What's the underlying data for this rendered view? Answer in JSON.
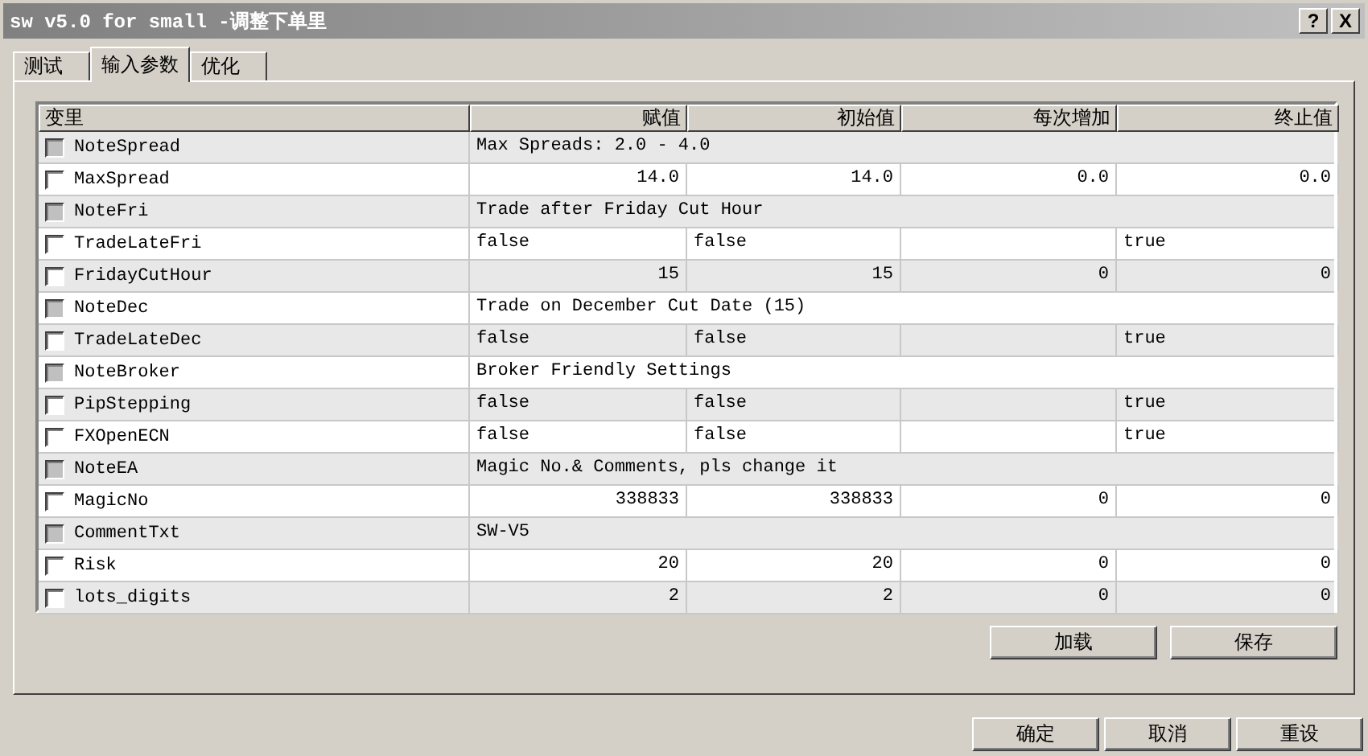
{
  "window": {
    "title": "sw v5.0 for small -调整下单里",
    "help": "?",
    "close": "X"
  },
  "tabs": [
    {
      "label": "测试",
      "selected": false
    },
    {
      "label": "输入参数",
      "selected": true
    },
    {
      "label": "优化",
      "selected": false
    }
  ],
  "table": {
    "columns": [
      "变里",
      "赋值",
      "初始值",
      "每次增加",
      "终止值"
    ],
    "rows": [
      {
        "kind": "note",
        "name": "NoteSpread",
        "checked": false,
        "value": "Max Spreads: 2.0 - 4.0"
      },
      {
        "kind": "number",
        "name": "MaxSpread",
        "checked": false,
        "value": "14.0",
        "start": "14.0",
        "step": "0.0",
        "stop": "0.0"
      },
      {
        "kind": "note",
        "name": "NoteFri",
        "checked": false,
        "value": "Trade after Friday Cut Hour"
      },
      {
        "kind": "bool",
        "name": "TradeLateFri",
        "checked": false,
        "value": "false",
        "start": "false",
        "stop": "true"
      },
      {
        "kind": "number",
        "name": "FridayCutHour",
        "checked": false,
        "value": "15",
        "start": "15",
        "step": "0",
        "stop": "0"
      },
      {
        "kind": "note",
        "name": "NoteDec",
        "checked": false,
        "value": "Trade on December Cut Date (15)"
      },
      {
        "kind": "bool",
        "name": "TradeLateDec",
        "checked": false,
        "value": "false",
        "start": "false",
        "stop": "true"
      },
      {
        "kind": "note",
        "name": "NoteBroker",
        "checked": false,
        "value": "Broker Friendly Settings"
      },
      {
        "kind": "bool",
        "name": "PipStepping",
        "checked": false,
        "value": "false",
        "start": "false",
        "stop": "true"
      },
      {
        "kind": "bool",
        "name": "FXOpenECN",
        "checked": false,
        "value": "false",
        "start": "false",
        "stop": "true"
      },
      {
        "kind": "note",
        "name": "NoteEA",
        "checked": false,
        "value": "Magic No.& Comments, pls change it"
      },
      {
        "kind": "number",
        "name": "MagicNo",
        "checked": false,
        "value": "338833",
        "start": "338833",
        "step": "0",
        "stop": "0"
      },
      {
        "kind": "note",
        "name": "CommentTxt",
        "checked": false,
        "value": "SW-V5"
      },
      {
        "kind": "number",
        "name": "Risk",
        "checked": false,
        "value": "20",
        "start": "20",
        "step": "0",
        "stop": "0"
      },
      {
        "kind": "number",
        "name": "lots_digits",
        "checked": false,
        "value": "2",
        "start": "2",
        "step": "0",
        "stop": "0"
      }
    ]
  },
  "panel_buttons": [
    "加载",
    "保存"
  ],
  "dialog_buttons": [
    "确定",
    "取消",
    "重设"
  ]
}
